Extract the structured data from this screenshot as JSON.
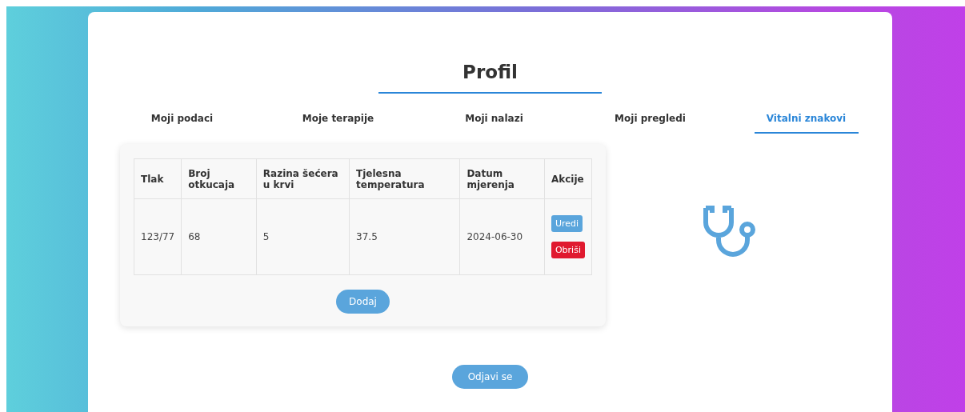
{
  "title": "Profil",
  "tabs": [
    {
      "label": "Moji podaci",
      "selected": false
    },
    {
      "label": "Moje terapije",
      "selected": false
    },
    {
      "label": "Moji nalazi",
      "selected": false
    },
    {
      "label": "Moji pregledi",
      "selected": false
    },
    {
      "label": "Vitalni znakovi",
      "selected": true
    }
  ],
  "table": {
    "columns": [
      "Tlak",
      "Broj otkucaja",
      "Razina šećera u krvi",
      "Tjelesna temperatura",
      "Datum mjerenja",
      "Akcije"
    ],
    "rows": [
      {
        "cells": [
          "123/77",
          "68",
          "5",
          "37.5",
          "2024-06-30"
        ],
        "actions": [
          {
            "label": "Uredi",
            "kind": "edit"
          },
          {
            "label": "Obriši",
            "kind": "delete"
          }
        ]
      }
    ]
  },
  "add_button": "Dodaj",
  "logout_button": "Odjavi se"
}
